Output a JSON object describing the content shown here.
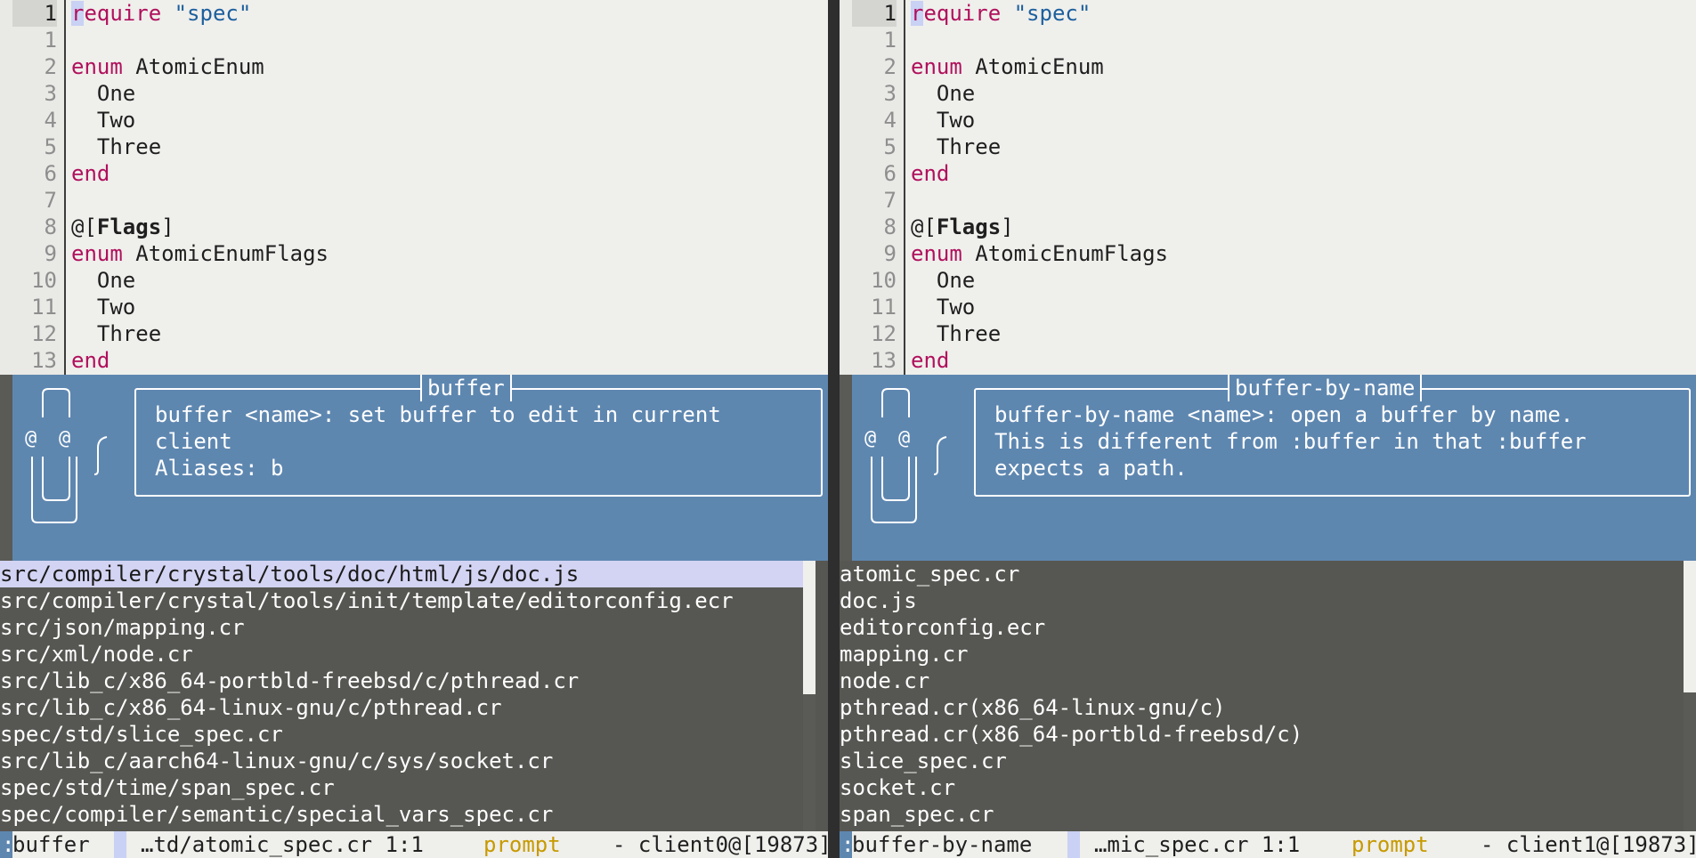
{
  "code_lines": [
    {
      "num": "1",
      "segments": [
        {
          "t": "r",
          "c": "kw cursor"
        },
        {
          "t": "equire",
          "c": "kw"
        },
        {
          "t": " ",
          "c": ""
        },
        {
          "t": "\"spec\"",
          "c": "str"
        }
      ]
    },
    {
      "num": "1",
      "segments": []
    },
    {
      "num": "2",
      "segments": [
        {
          "t": "enum",
          "c": "kw"
        },
        {
          "t": " AtomicEnum",
          "c": ""
        }
      ]
    },
    {
      "num": "3",
      "segments": [
        {
          "t": "  One",
          "c": ""
        }
      ]
    },
    {
      "num": "4",
      "segments": [
        {
          "t": "  Two",
          "c": ""
        }
      ]
    },
    {
      "num": "5",
      "segments": [
        {
          "t": "  Three",
          "c": ""
        }
      ]
    },
    {
      "num": "6",
      "segments": [
        {
          "t": "end",
          "c": "kw"
        }
      ]
    },
    {
      "num": "7",
      "segments": []
    },
    {
      "num": "8",
      "segments": [
        {
          "t": "@[",
          "c": ""
        },
        {
          "t": "Flags",
          "c": "bold"
        },
        {
          "t": "]",
          "c": ""
        }
      ]
    },
    {
      "num": "9",
      "segments": [
        {
          "t": "enum",
          "c": "kw"
        },
        {
          "t": " AtomicEnumFlags",
          "c": ""
        }
      ]
    },
    {
      "num": "10",
      "segments": [
        {
          "t": "  One",
          "c": ""
        }
      ]
    },
    {
      "num": "11",
      "segments": [
        {
          "t": "  Two",
          "c": ""
        }
      ]
    },
    {
      "num": "12",
      "segments": [
        {
          "t": "  Three",
          "c": ""
        }
      ]
    },
    {
      "num": "13",
      "segments": [
        {
          "t": "end",
          "c": "kw"
        }
      ]
    }
  ],
  "left": {
    "info_title": "buffer",
    "info_text": "buffer <name>: set buffer to edit in current\nclient\nAliases: b",
    "menu_items": [
      "src/compiler/crystal/tools/doc/html/js/doc.js",
      "src/compiler/crystal/tools/init/template/editorconfig.ecr",
      "src/json/mapping.cr",
      "src/xml/node.cr",
      "src/lib_c/x86_64-portbld-freebsd/c/pthread.cr",
      "src/lib_c/x86_64-linux-gnu/c/pthread.cr",
      "spec/std/slice_spec.cr",
      "src/lib_c/aarch64-linux-gnu/c/sys/socket.cr",
      "spec/std/time/span_spec.cr",
      "spec/compiler/semantic/special_vars_spec.cr"
    ],
    "status_mode": ":",
    "status_cmd": "buffer",
    "status_file": "…td/atomic_spec.cr 1:1",
    "status_prompt": "prompt",
    "status_client": "- client0@[19873]"
  },
  "right": {
    "info_title": "buffer-by-name",
    "info_text": "buffer-by-name <name>: open a buffer by name.\nThis is different from :buffer in that :buffer\nexpects a path.",
    "menu_items": [
      "atomic_spec.cr",
      "doc.js",
      "editorconfig.ecr",
      "mapping.cr",
      "node.cr",
      "pthread.cr(x86_64-linux-gnu/c)",
      "pthread.cr(x86_64-portbld-freebsd/c)",
      "slice_spec.cr",
      "socket.cr",
      "span_spec.cr"
    ],
    "status_mode": ":",
    "status_cmd": "buffer-by-name",
    "status_file": "…mic_spec.cr 1:1",
    "status_prompt": "prompt",
    "status_client": "- client1@[19873]"
  },
  "clippy_eyes": "@  @"
}
